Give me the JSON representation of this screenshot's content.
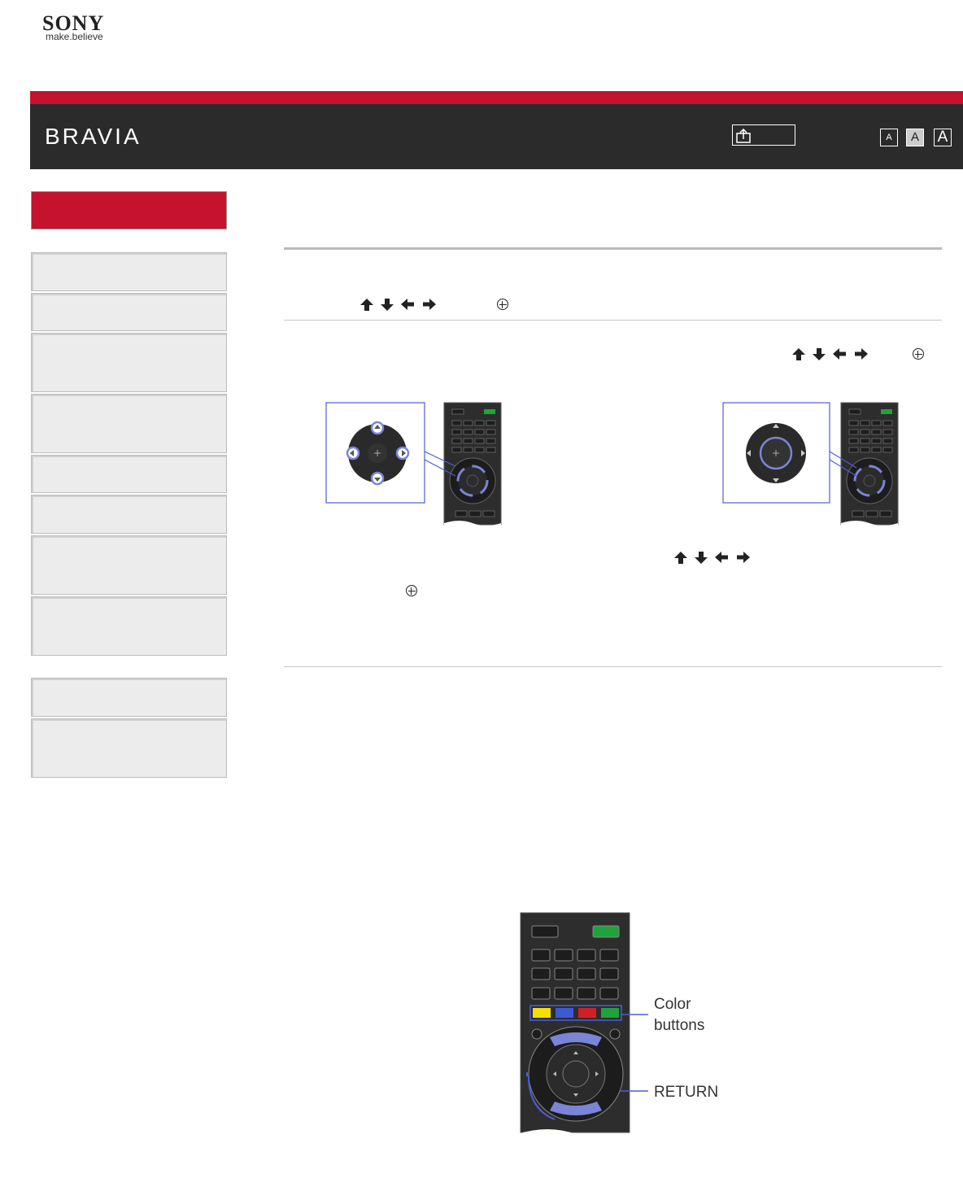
{
  "brand": {
    "logo": "SONY",
    "tagline": "make.believe",
    "product": "BRAVIA"
  },
  "header": {
    "home_icon": "home-icon",
    "font_size_buttons": [
      "A",
      "A",
      "A"
    ]
  },
  "remote_callouts": {
    "color_buttons": "Color\nbuttons",
    "return": "RETURN"
  },
  "icons": {
    "arrows": [
      "up-arrow-icon",
      "down-arrow-icon",
      "left-arrow-icon",
      "right-arrow-icon"
    ],
    "ok": "enter-icon"
  },
  "colors": {
    "brand_red": "#c4122f",
    "header_dark": "#2b2b2b",
    "highlight_blue": "#7b84d6",
    "sidebar_gray": "#ececec"
  }
}
